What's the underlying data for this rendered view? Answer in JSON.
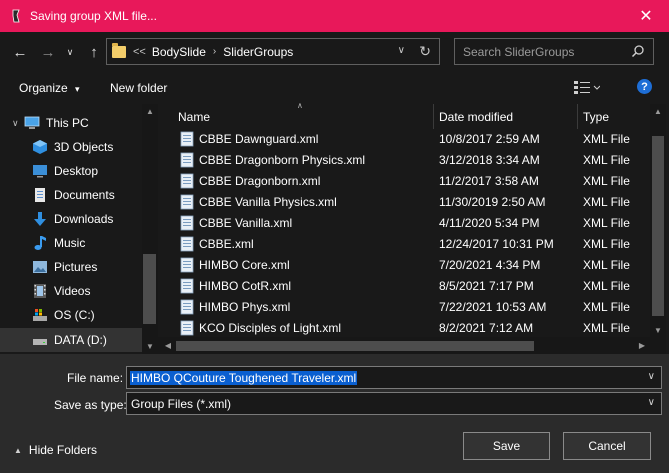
{
  "window": {
    "title": "Saving group XML file..."
  },
  "address": {
    "crumbs": [
      "BodySlide",
      "SliderGroups"
    ],
    "overflow": "<<"
  },
  "search": {
    "placeholder": "Search SliderGroups"
  },
  "toolbar": {
    "organize": "Organize",
    "new_folder": "New folder"
  },
  "nav": {
    "items": [
      {
        "label": "This PC",
        "icon": "computer-icon"
      },
      {
        "label": "3D Objects",
        "icon": "cube-icon"
      },
      {
        "label": "Desktop",
        "icon": "desktop-icon"
      },
      {
        "label": "Documents",
        "icon": "document-icon"
      },
      {
        "label": "Downloads",
        "icon": "download-icon"
      },
      {
        "label": "Music",
        "icon": "music-icon"
      },
      {
        "label": "Pictures",
        "icon": "picture-icon"
      },
      {
        "label": "Videos",
        "icon": "video-icon"
      },
      {
        "label": "OS (C:)",
        "icon": "drive-os-icon"
      },
      {
        "label": "DATA (D:)",
        "icon": "drive-icon"
      }
    ]
  },
  "columns": {
    "name": "Name",
    "date": "Date modified",
    "type": "Type"
  },
  "files": [
    {
      "name": "CBBE Dawnguard.xml",
      "date": "10/8/2017 2:59 AM",
      "type": "XML File"
    },
    {
      "name": "CBBE Dragonborn Physics.xml",
      "date": "3/12/2018 3:34 AM",
      "type": "XML File"
    },
    {
      "name": "CBBE Dragonborn.xml",
      "date": "11/2/2017 3:58 AM",
      "type": "XML File"
    },
    {
      "name": "CBBE Vanilla Physics.xml",
      "date": "11/30/2019 2:50 AM",
      "type": "XML File"
    },
    {
      "name": "CBBE Vanilla.xml",
      "date": "4/11/2020 5:34 PM",
      "type": "XML File"
    },
    {
      "name": "CBBE.xml",
      "date": "12/24/2017 10:31 PM",
      "type": "XML File"
    },
    {
      "name": "HIMBO Core.xml",
      "date": "7/20/2021 4:34 PM",
      "type": "XML File"
    },
    {
      "name": "HIMBO CotR.xml",
      "date": "8/5/2021 7:17 PM",
      "type": "XML File"
    },
    {
      "name": "HIMBO Phys.xml",
      "date": "7/22/2021 10:53 AM",
      "type": "XML File"
    },
    {
      "name": "KCO Disciples of Light.xml",
      "date": "8/2/2021 7:12 AM",
      "type": "XML File"
    }
  ],
  "form": {
    "file_name_label": "File name:",
    "file_name_value": "HIMBO QCouture Toughened Traveler.xml",
    "save_type_label": "Save as type:",
    "save_type_value": "Group Files (*.xml)"
  },
  "footer": {
    "hide_folders": "Hide Folders",
    "save": "Save",
    "cancel": "Cancel"
  },
  "colors": {
    "titlebar": "#e8185a",
    "selection": "#0a5fd0",
    "background": "#191919",
    "footer": "#2b2b2b"
  }
}
